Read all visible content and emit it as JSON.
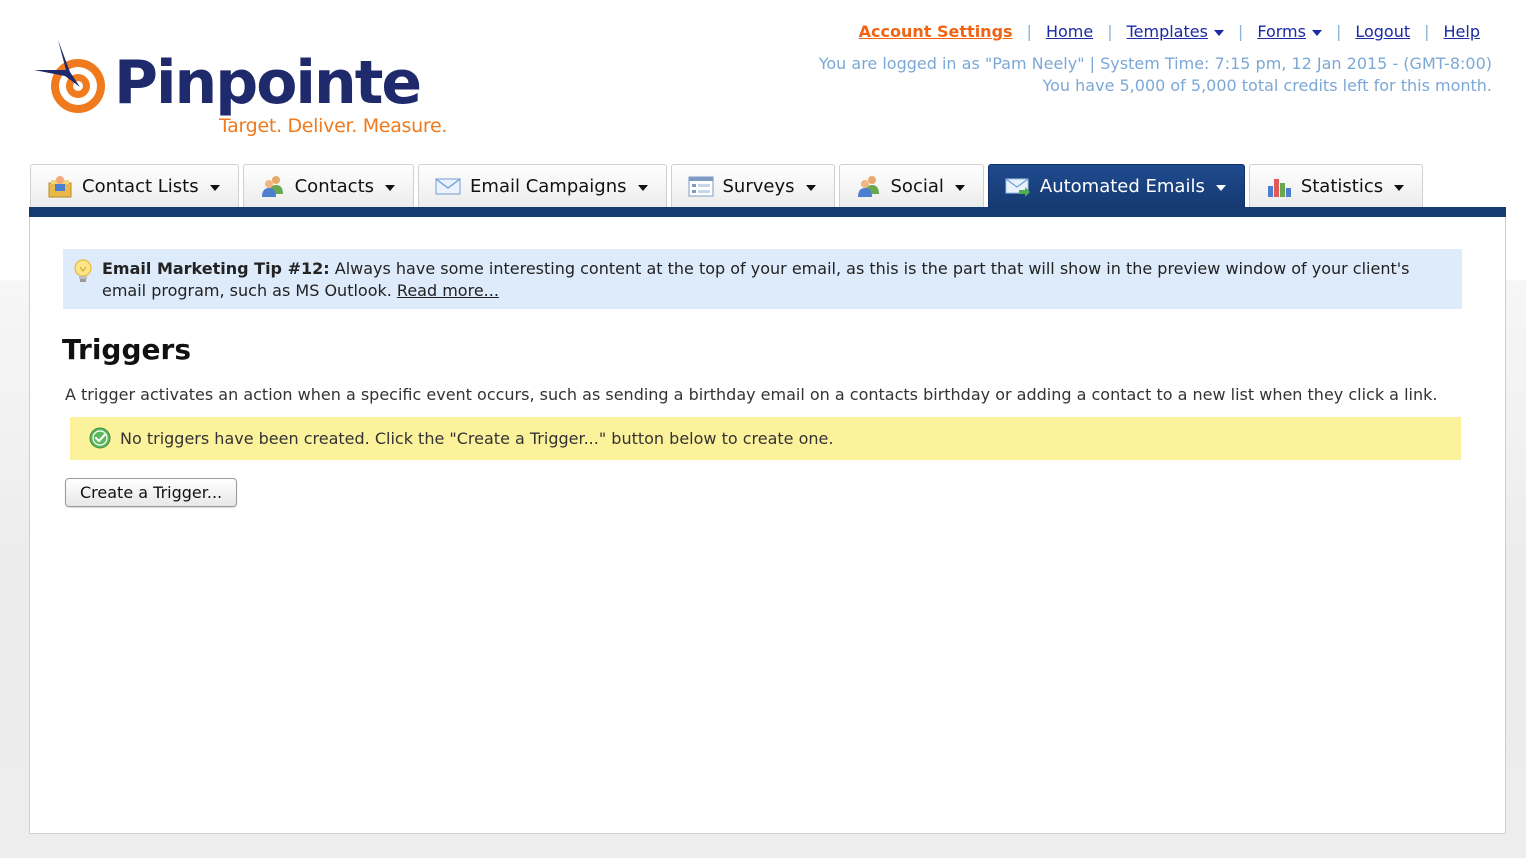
{
  "brand": {
    "name": "Pinpointe",
    "tagline": "Target. Deliver. Measure."
  },
  "top_nav": {
    "account_settings": "Account Settings",
    "home": "Home",
    "templates": "Templates",
    "forms": "Forms",
    "logout": "Logout",
    "help": "Help",
    "separator": "|"
  },
  "status": {
    "logged_in": "You are logged in as \"Pam Neely\" | System Time: 7:15 pm, 12 Jan 2015 - (GMT-8:00)",
    "credits": "You have 5,000 of 5,000 total credits left for this month."
  },
  "tabs": [
    {
      "label": "Contact Lists",
      "icon": "contact-lists-icon"
    },
    {
      "label": "Contacts",
      "icon": "contacts-icon"
    },
    {
      "label": "Email Campaigns",
      "icon": "email-envelope-icon"
    },
    {
      "label": "Surveys",
      "icon": "survey-form-icon"
    },
    {
      "label": "Social",
      "icon": "social-people-icon"
    },
    {
      "label": "Automated Emails",
      "icon": "automated-email-icon",
      "active": true
    },
    {
      "label": "Statistics",
      "icon": "bar-chart-icon"
    }
  ],
  "tip": {
    "title": "Email Marketing Tip #12:",
    "text": " Always have some interesting content at the top of your email, as this is the part that will show in the preview window of your client's email program, such as MS Outlook. ",
    "link": "Read more...",
    "icon": "lightbulb-icon"
  },
  "page": {
    "title": "Triggers",
    "description": "A trigger activates an action when a specific event occurs, such as sending a birthday email on a contacts birthday or adding a contact to a new list when they click a link.",
    "notice": "No triggers have been created.  Click the \"Create a Trigger...\" button below to create one.",
    "notice_icon": "success-check-icon",
    "create_button": "Create a Trigger..."
  },
  "colors": {
    "brand_navy": "#1f2a6c",
    "brand_orange": "#f07a1e",
    "active_tab": "#163a72",
    "link": "#1b2aa5",
    "active_link": "#f06414",
    "status_text": "#7ba8d6",
    "tip_bg": "#deebfb",
    "notice_bg": "#fdf29c"
  }
}
